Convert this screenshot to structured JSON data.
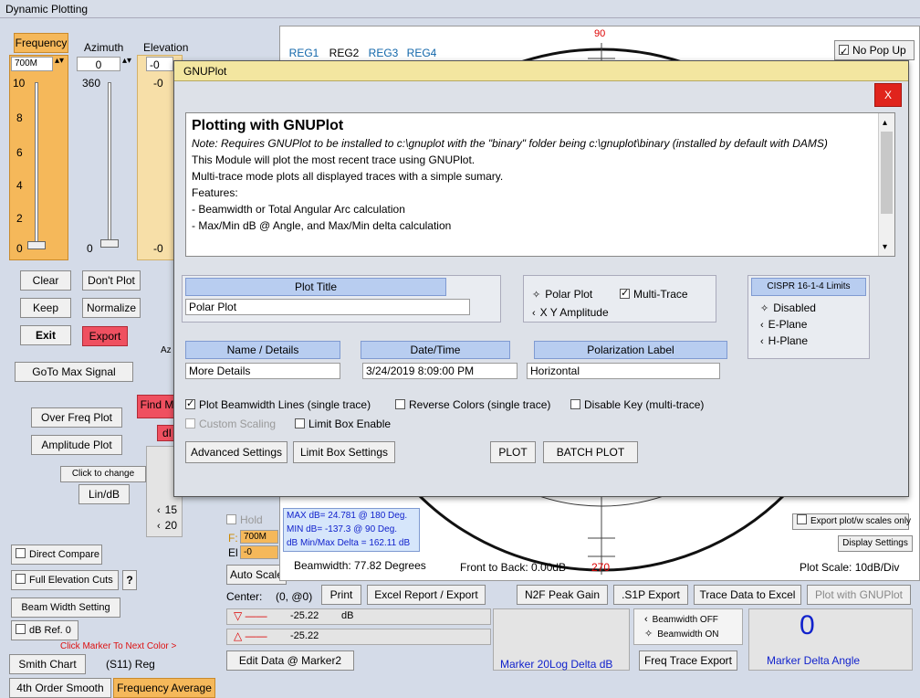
{
  "window": {
    "title": "Dynamic Plotting"
  },
  "left": {
    "freq_tab": "Frequency",
    "azimuth_tab": "Azimuth",
    "elevation_tab": "Elevation",
    "freq_value": "700M",
    "az_value": "0",
    "el_value": "-0",
    "freq_scale": [
      "10",
      "8",
      "6",
      "4",
      "2",
      "0"
    ],
    "az_top": "360",
    "az_bottom": "0",
    "el_top": "-0",
    "el_bottom": "-0",
    "clear": "Clear",
    "dont_plot": "Don't Plot",
    "keep": "Keep",
    "normalize": "Normalize",
    "exit": "Exit",
    "export": "Export",
    "az_short": "Az",
    "goto_max": "GoTo Max Signal",
    "find_m": "Find M",
    "over_freq": "Over Freq Plot",
    "amplitude": "Amplitude Plot",
    "click_change": "Click to change",
    "lin_db": "Lin/dB",
    "db_short": "dI",
    "num15": "15",
    "num20": "20",
    "direct_compare": "Direct Compare",
    "full_elev": "Full Elevation Cuts",
    "question": "?",
    "beam_width_setting": "Beam Width Setting",
    "db_ref": "dB Ref. 0",
    "click_marker": "Click Marker To Next Color >",
    "smith_chart": "Smith Chart",
    "s11": "(S11) Reg",
    "smooth": "4th Order Smooth",
    "freq_avg": "Frequency Average"
  },
  "mid": {
    "hold": "Hold",
    "f_label": "F:",
    "f_value": "700M",
    "el_label": "El",
    "el_value": "-0",
    "auto_scale": "Auto Scale",
    "center_label": "Center:",
    "center_value": "(0, @0)",
    "print": "Print",
    "excel_report": "Excel Report / Export",
    "marker1_val": "-25.22",
    "marker1_unit": "dB",
    "marker2_val": "-25.22",
    "edit_data": "Edit Data @ Marker2",
    "max_db": "MAX dB= 24.781 @ 180 Deg.",
    "min_db": "MIN dB= -137.3 @ 90 Deg.",
    "delta": "dB Min/Max Delta = 162.11 dB"
  },
  "plot": {
    "regs": [
      "REG1",
      "REG2",
      "REG3",
      "REG4"
    ],
    "no_popup": "No Pop Up",
    "angle_top": "90",
    "angle_bottom": "270",
    "beamwidth": "Beamwidth:  77.82 Degrees",
    "front_back": "Front to Back: 0.00dB",
    "plot_scale": "Plot Scale: 10dB/Div",
    "export_scales": "Export plot/w scales only",
    "display_settings": "Display Settings",
    "n2f": "N2F Peak Gain",
    "s1p": ".S1P Export",
    "trace_excel": "Trace Data to Excel",
    "plot_gnuplot": "Plot with GNUPlot",
    "bw_off": "Beamwidth OFF",
    "bw_on": "Beamwidth ON",
    "marker_delta": "0",
    "marker20log": "Marker 20Log Delta dB",
    "freq_trace_export": "Freq Trace Export",
    "marker_delta_angle": "Marker Delta Angle"
  },
  "dialog": {
    "title": "GNUPlot",
    "close": "X",
    "heading": "Plotting with GNUPlot",
    "note": "Note: Requires GNUPlot to be installed to c:\\gnuplot with the \"binary\" folder being c:\\gnuplot\\binary (installed by default with DAMS)",
    "line1": "This Module will plot the most recent trace using GNUPlot.",
    "line2": "Multi-trace mode plots all displayed traces with a simple sumary.",
    "line3": "Features:",
    "line4": "- Beamwidth or Total Angular Arc calculation",
    "line5": "- Max/Min dB @ Angle, and Max/Min delta calculation",
    "plot_title_hdr": "Plot Title",
    "plot_title_val": "Polar Plot",
    "polar_plot": "Polar Plot",
    "multi_trace": "Multi-Trace",
    "xy_amp": "X Y Amplitude",
    "cispr_hdr": "CISPR 16-1-4 Limits",
    "disabled": "Disabled",
    "e_plane": "E-Plane",
    "h_plane": "H-Plane",
    "name_hdr": "Name / Details",
    "name_val": "More Details",
    "date_hdr": "Date/Time",
    "date_val": "3/24/2019 8:09:00 PM",
    "pol_hdr": "Polarization Label",
    "pol_val": "Horizontal",
    "plot_bw": "Plot Beamwidth Lines (single trace)",
    "reverse": "Reverse Colors (single trace)",
    "disable_key": "Disable Key (multi-trace)",
    "custom_scaling": "Custom Scaling",
    "limit_box_enable": "Limit Box Enable",
    "advanced": "Advanced Settings",
    "limit_box_settings": "Limit Box Settings",
    "plot_btn": "PLOT",
    "batch_btn": "BATCH PLOT"
  },
  "colors": {
    "orange": "#f5b85a",
    "dialog_title": "#f3e6a0",
    "close_red": "#e0241c",
    "header_blue": "#b8cdf0"
  }
}
